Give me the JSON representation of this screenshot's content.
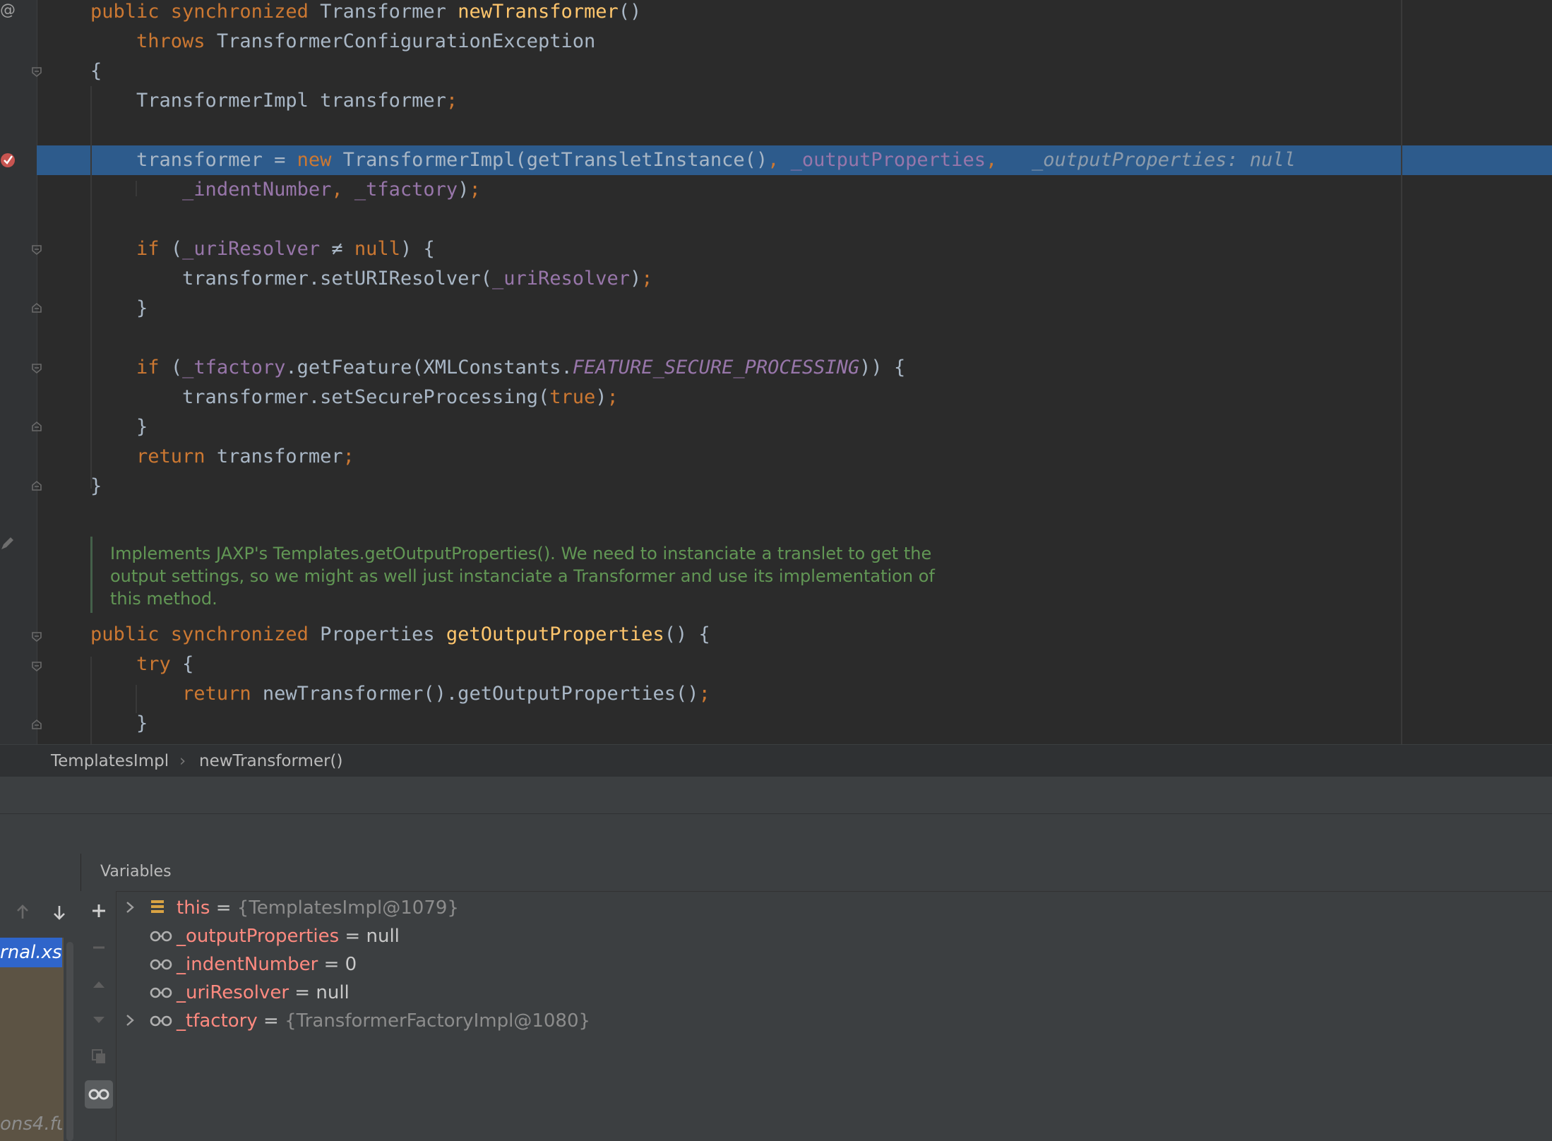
{
  "editor": {
    "lines": [
      {
        "segs": [
          [
            "kw",
            "public synchronized "
          ],
          [
            "pl",
            "Transformer "
          ],
          [
            "fn",
            "newTransformer"
          ],
          [
            "pl",
            "()"
          ]
        ]
      },
      {
        "segs": [
          [
            "pl",
            "    "
          ],
          [
            "kw",
            "throws "
          ],
          [
            "pl",
            "TransformerConfigurationException"
          ]
        ]
      },
      {
        "segs": [
          [
            "pl",
            "{"
          ]
        ]
      },
      {
        "segs": [
          [
            "pl",
            "    TransformerImpl transformer"
          ],
          [
            "kw",
            ";"
          ]
        ]
      },
      {
        "segs": []
      },
      {
        "segs": [
          [
            "pl",
            "    transformer = "
          ],
          [
            "kw",
            "new "
          ],
          [
            "pl",
            "TransformerImpl(getTransletInstance()"
          ],
          [
            "kw",
            ", "
          ],
          [
            "fld",
            "_outputProperties"
          ],
          [
            "kw",
            ",  "
          ],
          [
            "hint",
            " _outputProperties: null"
          ]
        ]
      },
      {
        "segs": [
          [
            "pl",
            "        "
          ],
          [
            "fld",
            "_indentNumber"
          ],
          [
            "kw",
            ", "
          ],
          [
            "fld",
            "_tfactory"
          ],
          [
            "pl",
            ")"
          ],
          [
            "kw",
            ";"
          ]
        ]
      },
      {
        "segs": []
      },
      {
        "segs": [
          [
            "pl",
            "    "
          ],
          [
            "kw",
            "if "
          ],
          [
            "pl",
            "("
          ],
          [
            "fld",
            "_uriResolver "
          ],
          [
            "pl",
            "≠ "
          ],
          [
            "kw",
            "null"
          ],
          [
            "pl",
            ") {"
          ]
        ]
      },
      {
        "segs": [
          [
            "pl",
            "        transformer.setURIResolver("
          ],
          [
            "fld",
            "_uriResolver"
          ],
          [
            "pl",
            ")"
          ],
          [
            "kw",
            ";"
          ]
        ]
      },
      {
        "segs": [
          [
            "pl",
            "    }"
          ]
        ]
      },
      {
        "segs": []
      },
      {
        "segs": [
          [
            "pl",
            "    "
          ],
          [
            "kw",
            "if "
          ],
          [
            "pl",
            "("
          ],
          [
            "fld",
            "_tfactory"
          ],
          [
            "pl",
            ".getFeature(XMLConstants."
          ],
          [
            "cst",
            "FEATURE_SECURE_PROCESSING"
          ],
          [
            "pl",
            ")) {"
          ]
        ]
      },
      {
        "segs": [
          [
            "pl",
            "        transformer.setSecureProcessing("
          ],
          [
            "kw",
            "true"
          ],
          [
            "pl",
            ")"
          ],
          [
            "kw",
            ";"
          ]
        ]
      },
      {
        "segs": [
          [
            "pl",
            "    }"
          ]
        ]
      },
      {
        "segs": [
          [
            "pl",
            "    "
          ],
          [
            "kw",
            "return "
          ],
          [
            "pl",
            "transformer"
          ],
          [
            "kw",
            ";"
          ]
        ]
      },
      {
        "segs": [
          [
            "pl",
            "}"
          ]
        ]
      }
    ],
    "doc_comment": [
      "Implements JAXP's Templates.getOutputProperties(). We need to instanciate a translet to get the",
      "output settings, so we might as well just instanciate a Transformer and use its implementation of",
      "this method."
    ],
    "lines2": [
      {
        "segs": [
          [
            "kw",
            "public synchronized "
          ],
          [
            "pl",
            "Properties "
          ],
          [
            "fn",
            "getOutputProperties"
          ],
          [
            "pl",
            "() {"
          ]
        ]
      },
      {
        "segs": [
          [
            "pl",
            "    "
          ],
          [
            "kw",
            "try "
          ],
          [
            "pl",
            "{"
          ]
        ]
      },
      {
        "segs": [
          [
            "pl",
            "        "
          ],
          [
            "kw",
            "return "
          ],
          [
            "pl",
            "newTransformer().getOutputProperties()"
          ],
          [
            "kw",
            ";"
          ]
        ]
      },
      {
        "segs": [
          [
            "pl",
            "    }"
          ]
        ]
      }
    ]
  },
  "breadcrumb": {
    "class_name": "TemplatesImpl",
    "separator": "›",
    "method_name": "newTransformer()"
  },
  "frames": {
    "selected": "rnal.xsl",
    "bottom": "ons4.fu"
  },
  "variables": {
    "title": "Variables",
    "items": [
      {
        "expandable": true,
        "icon": "object-field-icon",
        "name": "this",
        "eq": " = ",
        "value": "{TemplatesImpl@1079}",
        "is_obj": true
      },
      {
        "expandable": false,
        "icon": "watch-glasses-icon",
        "name": "_outputProperties",
        "eq": " = ",
        "value": "null",
        "is_obj": false
      },
      {
        "expandable": false,
        "icon": "watch-glasses-icon",
        "name": "_indentNumber",
        "eq": " = ",
        "value": "0",
        "is_obj": false
      },
      {
        "expandable": false,
        "icon": "watch-glasses-icon",
        "name": "_uriResolver",
        "eq": " = ",
        "value": "null",
        "is_obj": false
      },
      {
        "expandable": true,
        "icon": "watch-glasses-icon",
        "name": "_tfactory",
        "eq": " = ",
        "value": "{TransformerFactoryImpl@1080}",
        "is_obj": true
      }
    ]
  },
  "gutter": {
    "top_marker": "@"
  },
  "colors": {
    "keyword": "#cc7832",
    "function": "#ffc66d",
    "field": "#9876aa",
    "plain": "#a9b7c6",
    "comment": "#629755",
    "highlight": "#2d5b8c",
    "breakpoint": "#c75450"
  }
}
